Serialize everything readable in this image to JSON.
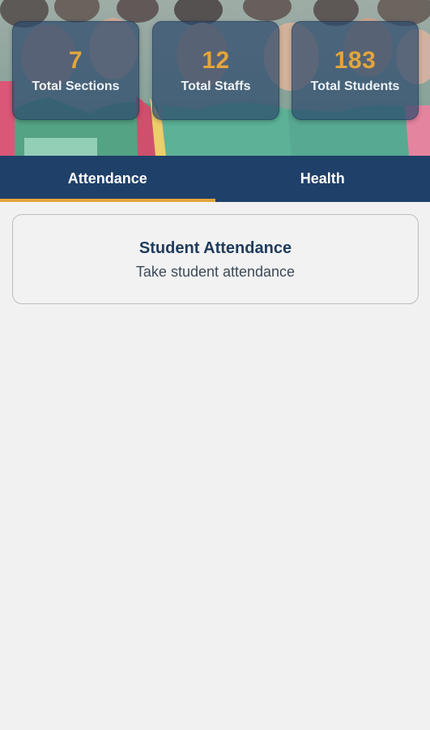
{
  "stats": [
    {
      "value": "7",
      "label": "Total Sections"
    },
    {
      "value": "12",
      "label": "Total Staffs"
    },
    {
      "value": "183",
      "label": "Total Students"
    }
  ],
  "tabs": [
    {
      "label": "Attendance",
      "selected": true
    },
    {
      "label": "Health",
      "selected": false
    }
  ],
  "attendance_card": {
    "title": "Student Attendance",
    "subtitle": "Take student attendance"
  },
  "colors": {
    "primary": "#1f4068",
    "accent": "#e3a53c",
    "background": "#f1f1f1",
    "card_text": "#1f3b5c"
  },
  "hero": {
    "image": "students-group-photo"
  }
}
